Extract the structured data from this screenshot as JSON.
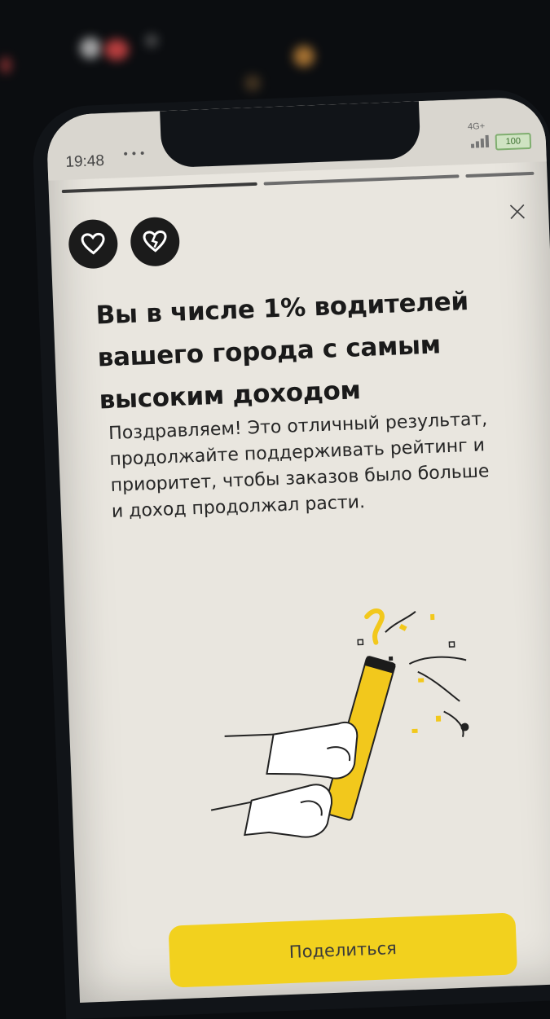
{
  "statusbar": {
    "time": "19:48",
    "menu_dots": "•••",
    "network": "4G+",
    "battery": "100"
  },
  "story": {
    "segments": 3,
    "active_segment": 1
  },
  "reactions": {
    "like_icon": "heart-icon",
    "dislike_icon": "broken-heart-icon"
  },
  "close_label": "×",
  "title": "Вы в числе 1% водителей вашего города с самым высоким доходом",
  "body": "Поздравляем! Это отличный результат, продолжайте поддерживать рейтинг и приоритет, чтобы заказов было больше и доход продолжал расти.",
  "illustration": "party-popper-hands",
  "share_button_label": "Поделиться",
  "colors": {
    "accent": "#f2d11e",
    "screen_bg": "#e9e6df",
    "dark": "#1b1b1b"
  }
}
